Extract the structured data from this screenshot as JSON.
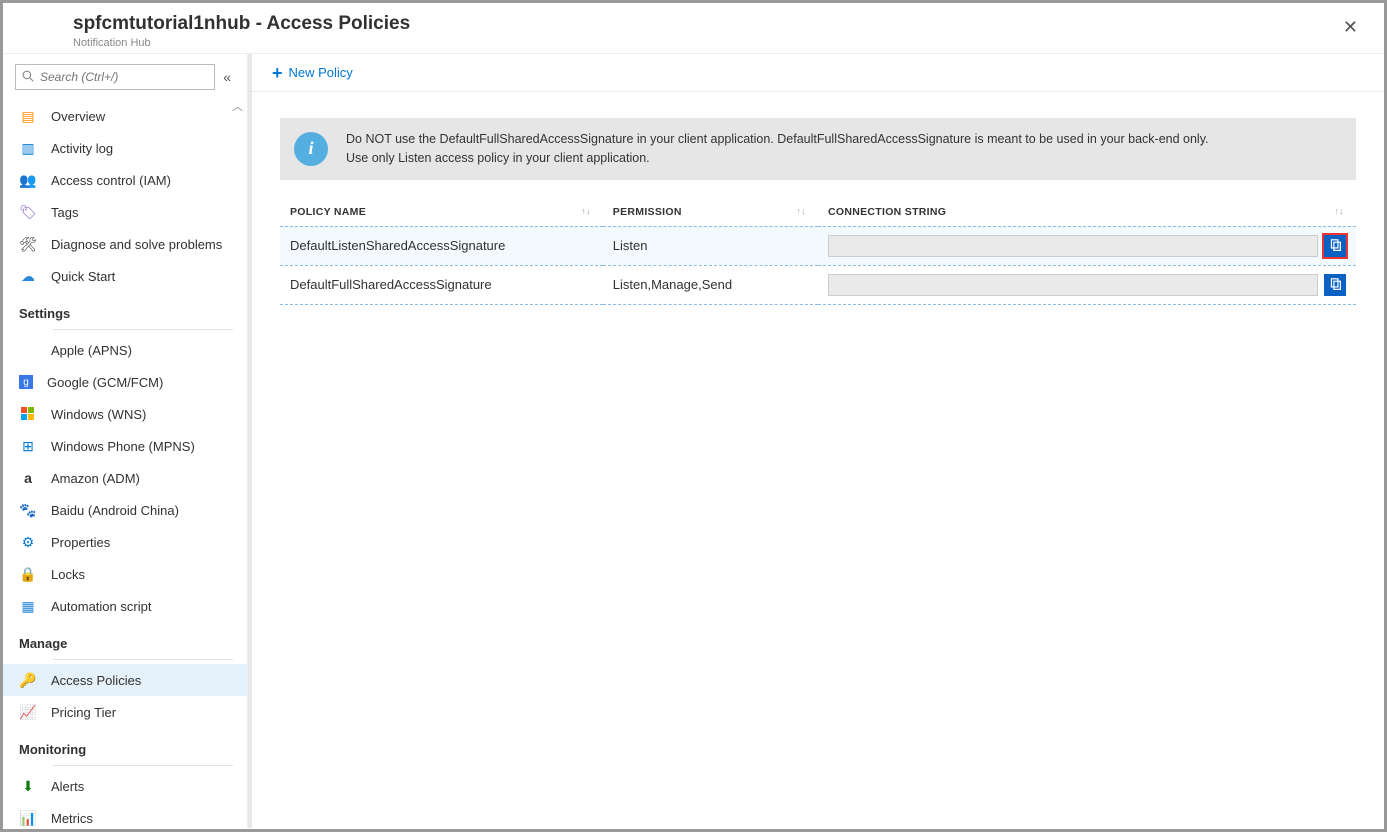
{
  "header": {
    "title": "spfcmtutorial1nhub - Access Policies",
    "subtitle": "Notification Hub"
  },
  "search": {
    "placeholder": "Search (Ctrl+/)"
  },
  "cmd": {
    "new_policy": "New Policy"
  },
  "info": {
    "line1": "Do NOT use the DefaultFullSharedAccessSignature in your client application.  DefaultFullSharedAccessSignature is meant to be used in your back-end only.",
    "line2": "Use only Listen access policy in your client application."
  },
  "table": {
    "col_policy": "POLICY NAME",
    "col_perm": "PERMISSION",
    "col_conn": "CONNECTION STRING",
    "rows": [
      {
        "name": "DefaultListenSharedAccessSignature",
        "perm": "Listen"
      },
      {
        "name": "DefaultFullSharedAccessSignature",
        "perm": "Listen,Manage,Send"
      }
    ]
  },
  "nav": {
    "root": [
      {
        "label": "Overview"
      },
      {
        "label": "Activity log"
      },
      {
        "label": "Access control (IAM)"
      },
      {
        "label": "Tags"
      },
      {
        "label": "Diagnose and solve problems"
      },
      {
        "label": "Quick Start"
      }
    ],
    "settings_h": "Settings",
    "settings": [
      {
        "label": "Apple (APNS)"
      },
      {
        "label": "Google (GCM/FCM)"
      },
      {
        "label": "Windows (WNS)"
      },
      {
        "label": "Windows Phone (MPNS)"
      },
      {
        "label": "Amazon (ADM)"
      },
      {
        "label": "Baidu (Android China)"
      },
      {
        "label": "Properties"
      },
      {
        "label": "Locks"
      },
      {
        "label": "Automation script"
      }
    ],
    "manage_h": "Manage",
    "manage": [
      {
        "label": "Access Policies"
      },
      {
        "label": "Pricing Tier"
      }
    ],
    "monitoring_h": "Monitoring",
    "monitoring": [
      {
        "label": "Alerts"
      },
      {
        "label": "Metrics"
      }
    ]
  }
}
